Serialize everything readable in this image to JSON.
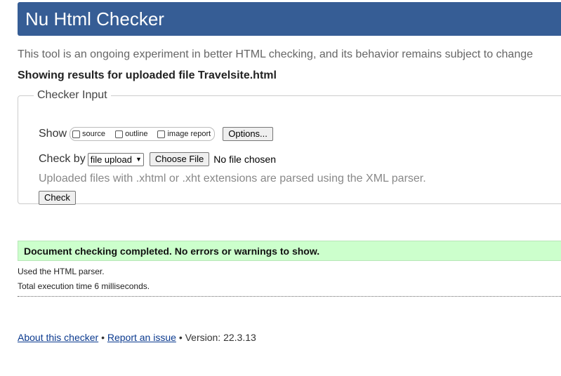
{
  "header": {
    "title": "Nu Html Checker"
  },
  "intro": "This tool is an ongoing experiment in better HTML checking, and its behavior remains subject to change",
  "results_for": "Showing results for uploaded file Travelsite.html",
  "checker": {
    "legend": "Checker Input",
    "show_label": "Show",
    "show_options": [
      {
        "label": "source",
        "checked": false
      },
      {
        "label": "outline",
        "checked": false
      },
      {
        "label": "image report",
        "checked": false
      }
    ],
    "options_button": "Options...",
    "check_by_label": "Check by",
    "check_by_select": "file upload",
    "choose_file_button": "Choose File",
    "no_file_text": "No file chosen",
    "hint": "Uploaded files with .xhtml or .xht extensions are parsed using the XML parser.",
    "check_button": "Check"
  },
  "status": {
    "message": "Document checking completed. No errors or warnings to show.",
    "color": "#ccffcc"
  },
  "details": {
    "parser": "Used the HTML parser.",
    "execution": "Total execution time 6 milliseconds."
  },
  "footer": {
    "about_link": "About this checker",
    "separator": "•",
    "report_link": "Report an issue",
    "version": "Version: 22.3.13"
  },
  "colors": {
    "header_bg": "#365d95",
    "status_bg": "#ccffcc"
  }
}
